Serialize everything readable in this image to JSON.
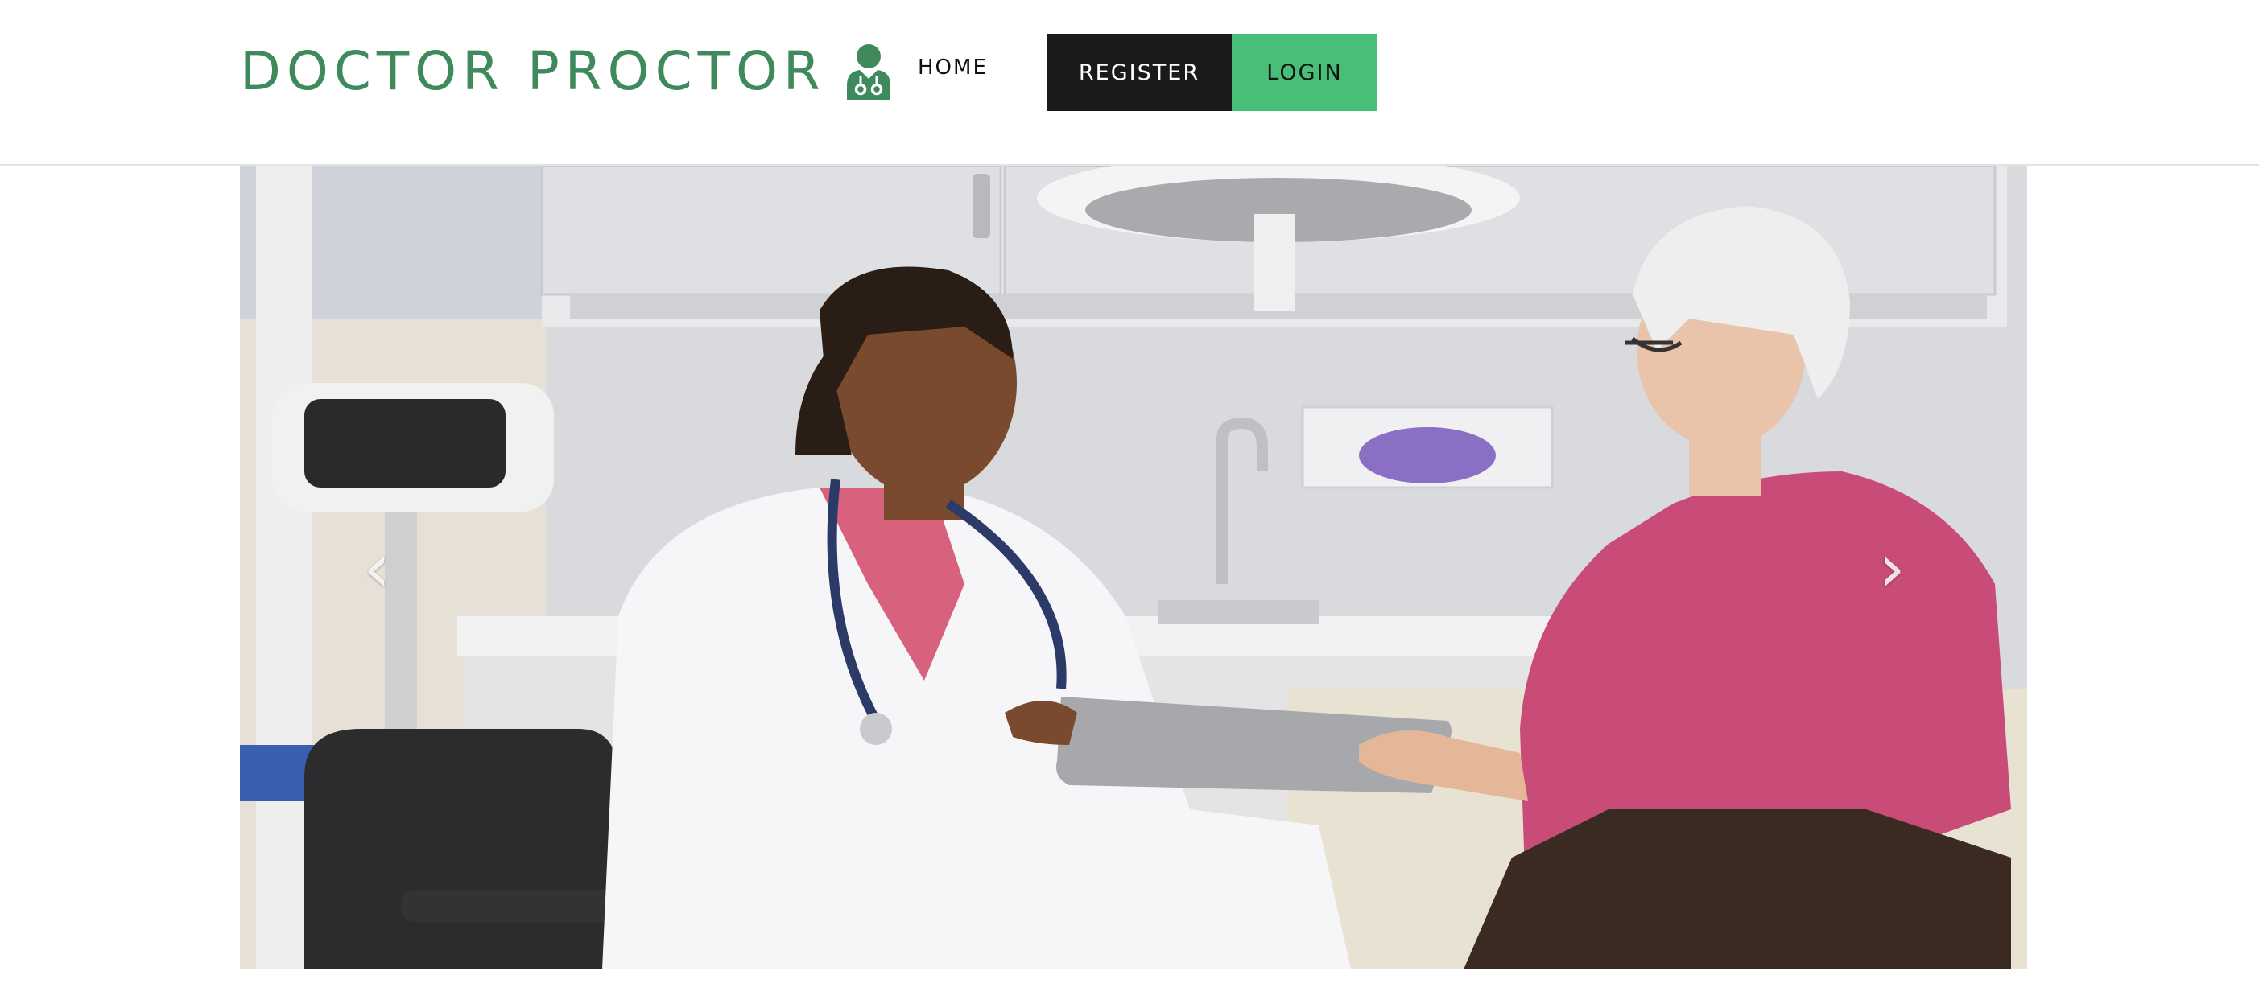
{
  "brand": {
    "name": "DOCTOR PROCTOR",
    "icon": "doctor-icon",
    "color": "#3e8a5c"
  },
  "nav": {
    "home_label": "HOME",
    "register_label": "REGISTER",
    "login_label": "LOGIN"
  },
  "colors": {
    "register_bg": "#1a1a1a",
    "login_bg": "#48bf78"
  },
  "carousel": {
    "prev_icon": "chevron-left-icon",
    "next_icon": "chevron-right-icon",
    "prev_glyph": "‹",
    "next_glyph": "›"
  }
}
